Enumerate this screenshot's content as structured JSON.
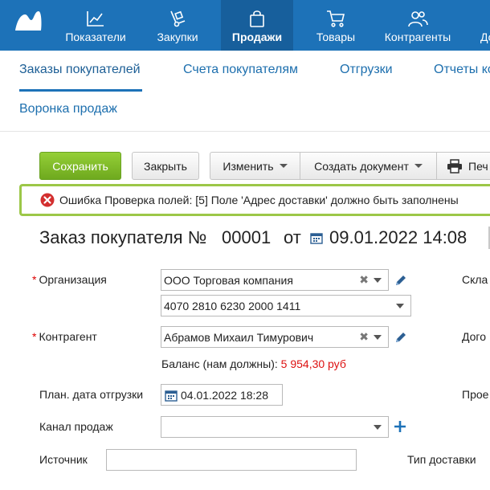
{
  "nav": {
    "items": [
      {
        "label": "Показатели",
        "icon": "chart-line-icon"
      },
      {
        "label": "Закупки",
        "icon": "hand-truck-icon"
      },
      {
        "label": "Продажи",
        "icon": "shopping-bag-icon",
        "active": true
      },
      {
        "label": "Товары",
        "icon": "cart-icon"
      },
      {
        "label": "Контрагенты",
        "icon": "people-icon"
      },
      {
        "label": "До"
      }
    ]
  },
  "tabs": {
    "items": [
      "Заказы покупателей",
      "Счета покупателям",
      "Отгрузки",
      "Отчеты ко",
      "Воронка продаж"
    ]
  },
  "toolbar": {
    "save": "Сохранить",
    "close": "Закрыть",
    "edit": "Изменить",
    "create_doc": "Создать документ",
    "print": "Печ"
  },
  "error": {
    "text": "Ошибка Проверка полей: [5] Поле 'Адрес доставки' должно быть заполнены"
  },
  "title": {
    "prefix": "Заказ покупателя №",
    "number": "00001",
    "from": "от",
    "datetime": "09.01.2022 14:08"
  },
  "form": {
    "org_label": "Организация",
    "org_value": "ООО Торговая компания",
    "account_value": "4070 2810 6230 2000 1411",
    "counterparty_label": "Контрагент",
    "counterparty_value": "Абрамов Михаил Тимурович",
    "balance_label": "Баланс (нам должны):",
    "balance_value": "5 954,30 руб",
    "ship_date_label": "План. дата отгрузки",
    "ship_date_value": "04.01.2022 18:28",
    "channel_label": "Канал продаж",
    "channel_value": "",
    "source_label": "Источник",
    "source_value": "",
    "right_labels": [
      "Скла",
      "Дого",
      "Прое",
      "Тип доставки"
    ]
  },
  "colors": {
    "nav_bg": "#1d72b8",
    "save_green": "#7cb82a",
    "error_border": "#9cc748",
    "negative": "#d11111"
  }
}
